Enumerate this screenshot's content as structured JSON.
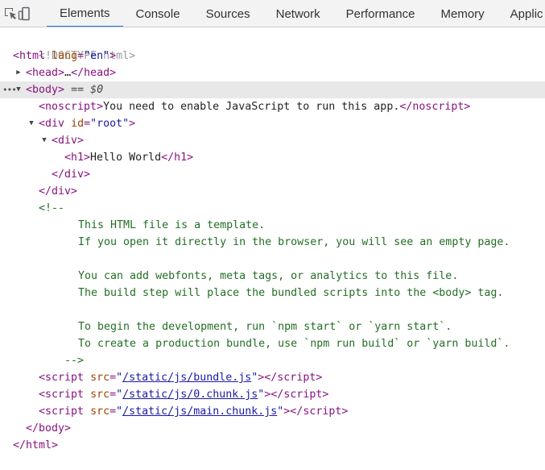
{
  "toolbar": {
    "tabs": [
      "Elements",
      "Console",
      "Sources",
      "Network",
      "Performance",
      "Memory",
      "Applic"
    ],
    "active_tab": "Elements"
  },
  "colors": {
    "tag": "#881280",
    "attr_name": "#994500",
    "attr_value": "#1a1aa6",
    "comment": "#236e25",
    "active_tab_underline": "#1a73e8",
    "selected_row": "#e8e8e8"
  },
  "dom": {
    "doctype": "<!DOCTYPE html>",
    "html_open": "html",
    "html_lang_attr": "lang",
    "html_lang_val": "en",
    "head_open": "head",
    "head_ellipsis": "…",
    "head_close": "head",
    "body_open": "body",
    "body_marker": "== $0",
    "noscript_open": "noscript",
    "noscript_text": "You need to enable JavaScript to run this app.",
    "noscript_close": "noscript",
    "div_root": "div",
    "div_root_attr": "id",
    "div_root_val": "root",
    "div_inner": "div",
    "h1_open": "h1",
    "h1_text": "Hello World",
    "h1_close": "h1",
    "div_inner_close": "div",
    "div_root_close": "div",
    "comment_open": "<!--",
    "comment_lines": [
      "This HTML file is a template.",
      "If you open it directly in the browser, you will see an empty page.",
      "",
      "You can add webfonts, meta tags, or analytics to this file.",
      "The build step will place the bundled scripts into the <body> tag.",
      "",
      "To begin the development, run `npm start` or `yarn start`.",
      "To create a production bundle, use `npm run build` or `yarn build`."
    ],
    "comment_close": "-->",
    "script_tag": "script",
    "script_attr": "src",
    "scripts": [
      "/static/js/bundle.js",
      "/static/js/0.chunk.js",
      "/static/js/main.chunk.js"
    ],
    "body_close": "body",
    "html_close": "html"
  }
}
